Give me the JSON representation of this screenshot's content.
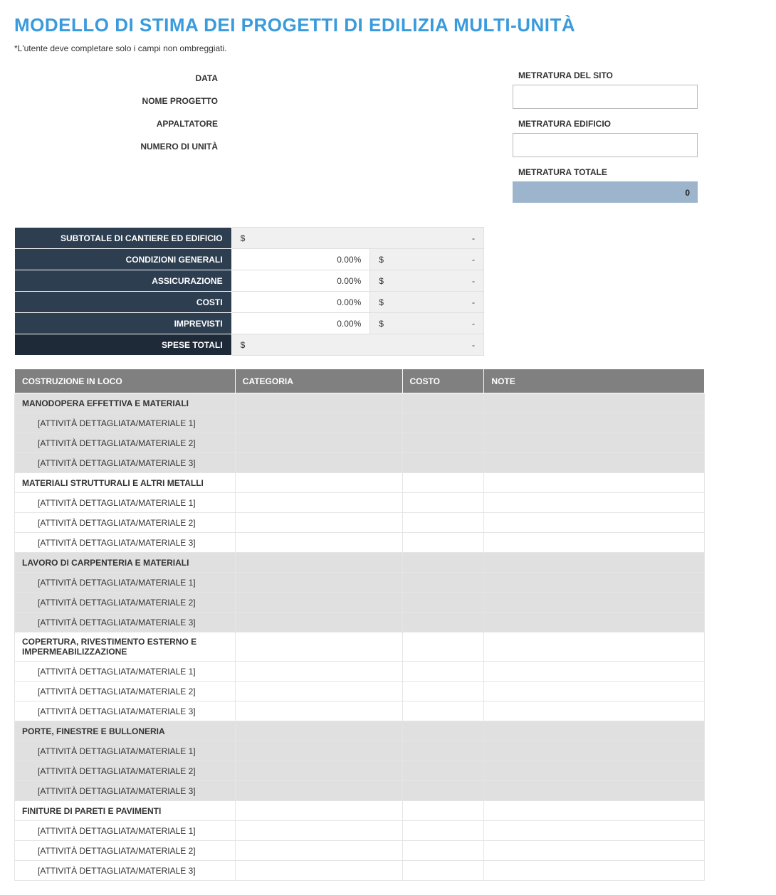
{
  "title": "MODELLO DI STIMA DEI PROGETTI DI EDILIZIA MULTI-UNITÀ",
  "note": "*L'utente deve completare solo i campi non ombreggiati.",
  "info_labels": {
    "data": "DATA",
    "nome_progetto": "NOME PROGETTO",
    "appaltatore": "APPALTATORE",
    "numero_unita": "NUMERO DI UNITÀ"
  },
  "metrics": {
    "site_label": "METRATURA DEL SITO",
    "building_label": "METRATURA EDIFICIO",
    "total_label": "METRATURA TOTALE",
    "total_value": "0"
  },
  "summary": {
    "subtotale": {
      "label": "SUBTOTALE DI CANTIERE ED EDIFICIO",
      "currency": "$",
      "amount": "-"
    },
    "condizioni": {
      "label": "CONDIZIONI GENERALI",
      "pct": "0.00%",
      "currency": "$",
      "amount": "-"
    },
    "assicurazione": {
      "label": "ASSICURAZIONE",
      "pct": "0.00%",
      "currency": "$",
      "amount": "-"
    },
    "costi": {
      "label": "COSTI",
      "pct": "0.00%",
      "currency": "$",
      "amount": "-"
    },
    "imprevisti": {
      "label": "IMPREVISTI",
      "pct": "0.00%",
      "currency": "$",
      "amount": "-"
    },
    "spese_totali": {
      "label": "SPESE TOTALI",
      "currency": "$",
      "amount": "-"
    }
  },
  "detail_headers": {
    "col1": "COSTRUZIONE IN LOCO",
    "col2": "CATEGORIA",
    "col3": "COSTO",
    "col4": "NOTE"
  },
  "groups": [
    {
      "name": "MANODOPERA EFFETTIVA E MATERIALI",
      "shaded": true,
      "items": [
        "[ATTIVITÀ DETTAGLIATA/MATERIALE 1]",
        "[ATTIVITÀ DETTAGLIATA/MATERIALE 2]",
        "[ATTIVITÀ DETTAGLIATA/MATERIALE 3]"
      ]
    },
    {
      "name": "MATERIALI STRUTTURALI E ALTRI METALLI",
      "shaded": false,
      "items": [
        "[ATTIVITÀ DETTAGLIATA/MATERIALE 1]",
        "[ATTIVITÀ DETTAGLIATA/MATERIALE 2]",
        "[ATTIVITÀ DETTAGLIATA/MATERIALE 3]"
      ]
    },
    {
      "name": "LAVORO DI CARPENTERIA E MATERIALI",
      "shaded": true,
      "items": [
        "[ATTIVITÀ DETTAGLIATA/MATERIALE 1]",
        "[ATTIVITÀ DETTAGLIATA/MATERIALE 2]",
        "[ATTIVITÀ DETTAGLIATA/MATERIALE 3]"
      ]
    },
    {
      "name": "COPERTURA, RIVESTIMENTO ESTERNO E IMPERMEABILIZZAZIONE",
      "shaded": false,
      "items": [
        "[ATTIVITÀ DETTAGLIATA/MATERIALE 1]",
        "[ATTIVITÀ DETTAGLIATA/MATERIALE 2]",
        "[ATTIVITÀ DETTAGLIATA/MATERIALE 3]"
      ]
    },
    {
      "name": "PORTE, FINESTRE E BULLONERIA",
      "shaded": true,
      "items": [
        "[ATTIVITÀ DETTAGLIATA/MATERIALE 1]",
        "[ATTIVITÀ DETTAGLIATA/MATERIALE 2]",
        "[ATTIVITÀ DETTAGLIATA/MATERIALE 3]"
      ]
    },
    {
      "name": "FINITURE DI PARETI E PAVIMENTI",
      "shaded": false,
      "items": [
        "[ATTIVITÀ DETTAGLIATA/MATERIALE 1]",
        "[ATTIVITÀ DETTAGLIATA/MATERIALE 2]",
        "[ATTIVITÀ DETTAGLIATA/MATERIALE 3]"
      ]
    }
  ]
}
